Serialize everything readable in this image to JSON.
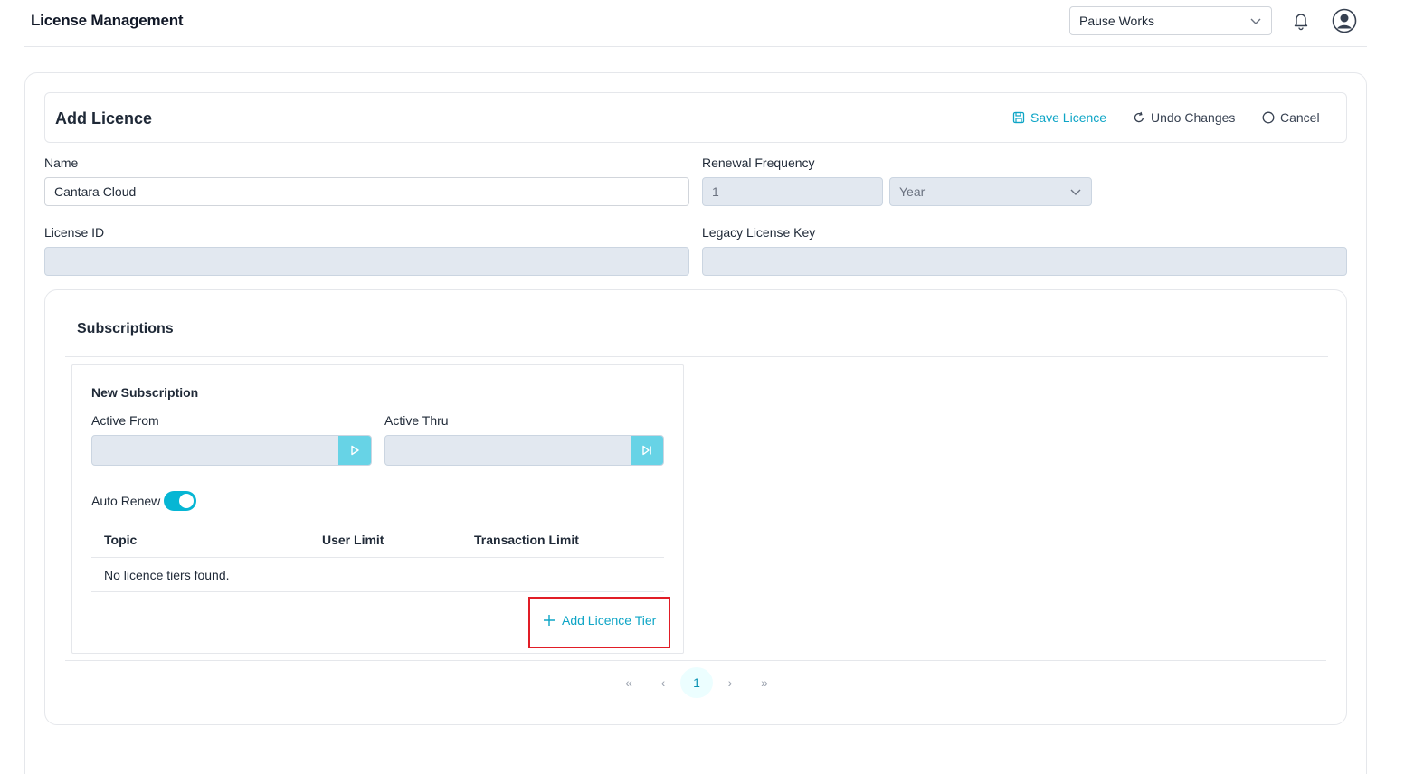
{
  "topbar": {
    "title": "License Management",
    "organization": "Pause Works"
  },
  "header": {
    "title": "Add Licence",
    "actions": {
      "save": "Save Licence",
      "undo": "Undo Changes",
      "cancel": "Cancel"
    }
  },
  "form": {
    "name_label": "Name",
    "name_value": "Cantara Cloud",
    "renewal_label": "Renewal Frequency",
    "renewal_count": "1",
    "renewal_unit": "Year",
    "license_id_label": "License ID",
    "license_id_value": "",
    "legacy_key_label": "Legacy License Key",
    "legacy_key_value": ""
  },
  "subscriptions": {
    "title": "Subscriptions",
    "panel": {
      "heading": "New Subscription",
      "active_from_label": "Active From",
      "active_thru_label": "Active Thru",
      "auto_renew_label": "Auto Renew",
      "auto_renew": true,
      "columns": [
        "Topic",
        "User Limit",
        "Transaction Limit"
      ],
      "empty_message": "No licence tiers found.",
      "add_tier_label": "Add Licence Tier"
    }
  },
  "pagination": {
    "first": "«",
    "prev": "‹",
    "current": "1",
    "next": "›",
    "last": "»"
  },
  "colors": {
    "accent": "#0ea5c6",
    "toggle_on": "#06b6d4",
    "highlight_border": "#e11d26",
    "disabled_field": "#e2e8f0"
  }
}
